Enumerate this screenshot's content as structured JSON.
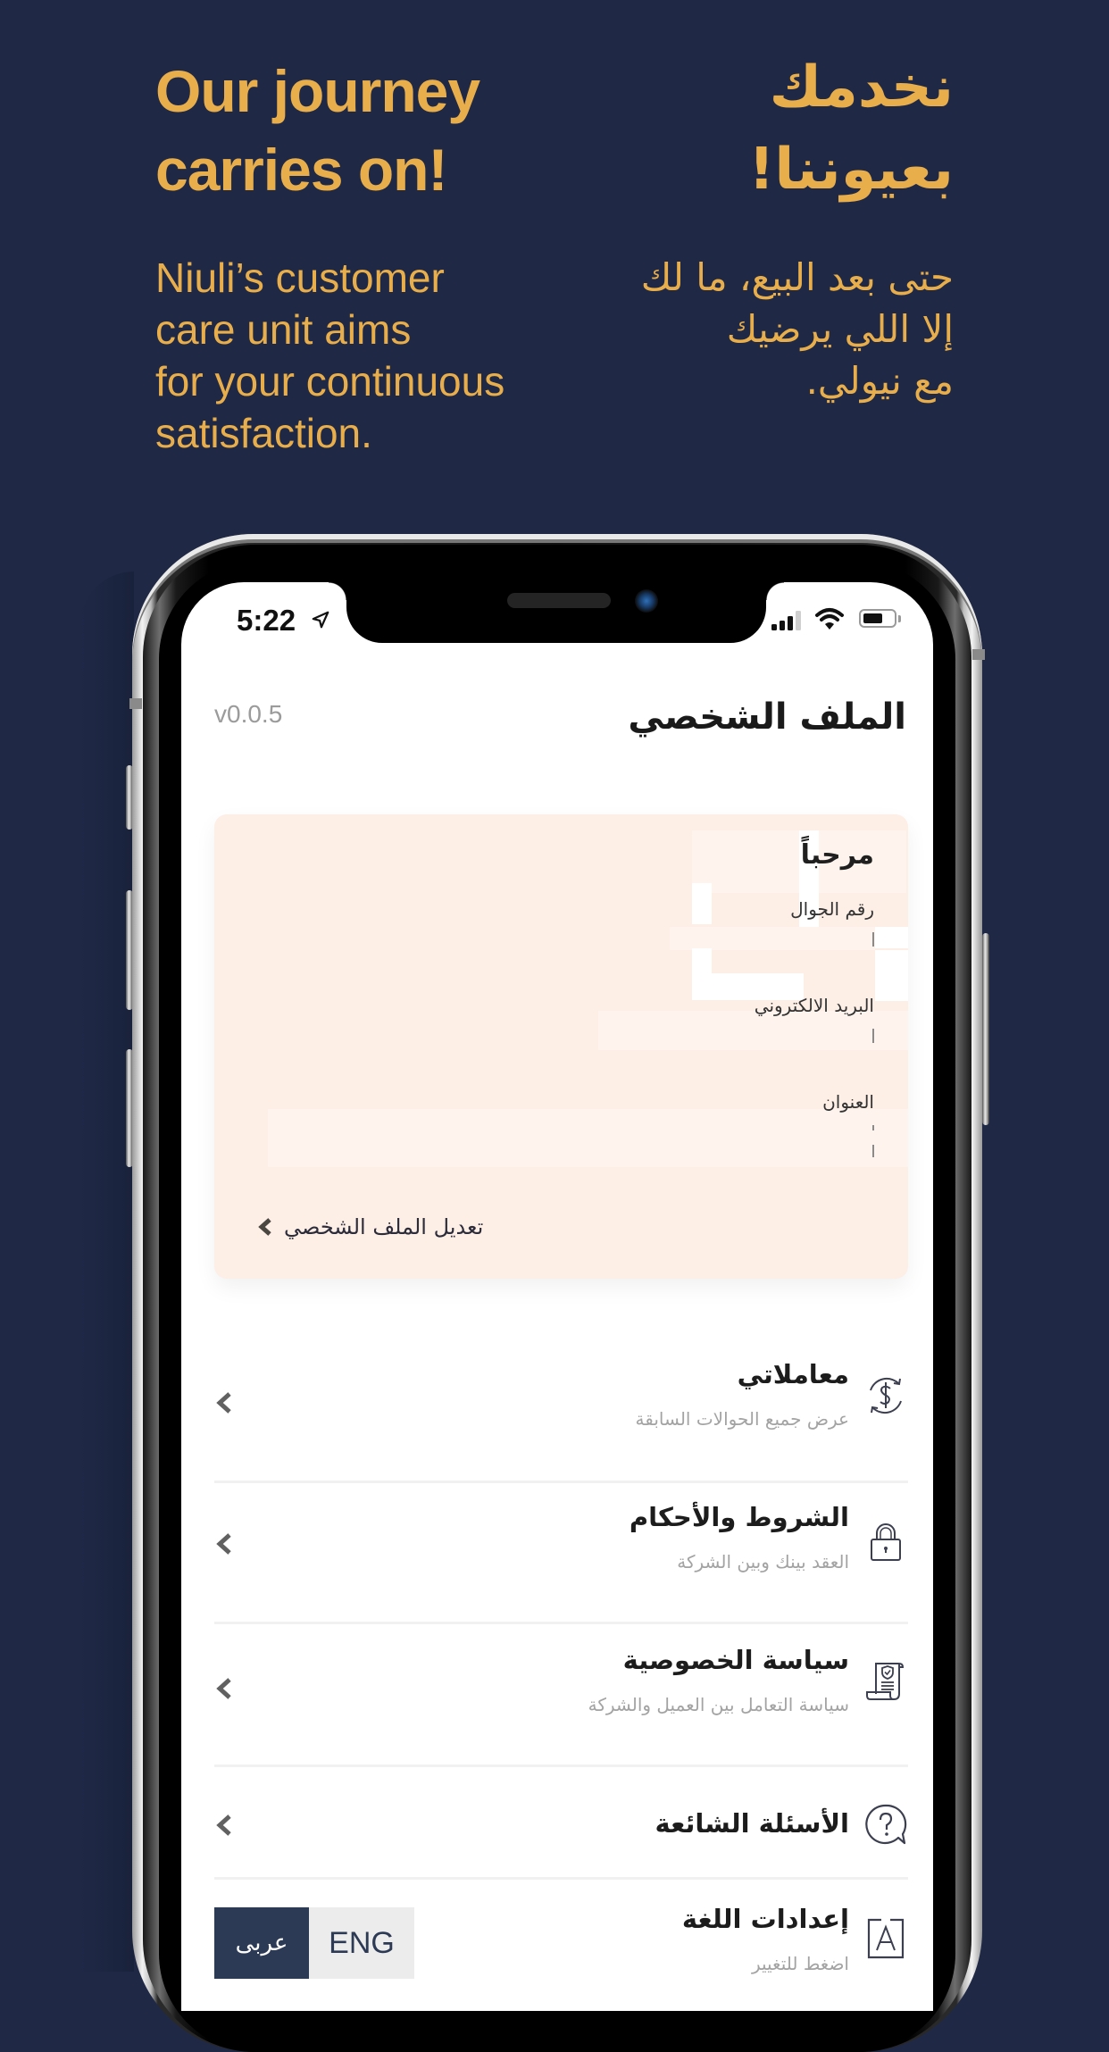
{
  "promo": {
    "en_title": "Our journey\ncarries on!",
    "ar_title": "نخدمك\nبعيوننا!",
    "en_body": "Niuli’s customer\ncare unit aims\nfor your continuous\nsatisfaction.",
    "ar_body": "حتى بعد البيع، ما لك\nإلا اللي يرضيك\nمع نيولي."
  },
  "colors": {
    "background": "#1f2946",
    "accent_gold": "#e8ae4c",
    "card_bg": "#fdeee6",
    "toggle_active": "#2d3a55",
    "toggle_inactive": "#ececec"
  },
  "status_bar": {
    "time": "5:22",
    "location_icon": "location-arrow-icon",
    "signal_bars_active": 3,
    "signal_bars_total": 4,
    "wifi_icon": "wifi-icon",
    "battery_level": 0.65
  },
  "header": {
    "version": "v0.0.5",
    "title": "الملف الشخصي"
  },
  "profile_card": {
    "greeting": "مرحباً",
    "fields": [
      {
        "label": "رقم الجوال",
        "value": ""
      },
      {
        "label": "البريد الالكتروني",
        "value": ""
      },
      {
        "label": "العنوان",
        "value": ""
      }
    ],
    "edit_link": "تعديل الملف الشخصي",
    "edit_icon": "chevron-left-icon"
  },
  "menu": {
    "items": [
      {
        "title": "معاملاتي",
        "subtitle": "عرض جميع الحوالات السابقة",
        "icon": "currency-exchange-icon"
      },
      {
        "title": "الشروط والأحكام",
        "subtitle": "العقد بينك وبين الشركة",
        "icon": "lock-icon"
      },
      {
        "title": "سياسة الخصوصية",
        "subtitle": "سياسة التعامل بين العميل والشركة",
        "icon": "privacy-document-icon"
      },
      {
        "title": "الأسئلة الشائعة",
        "subtitle": "",
        "icon": "question-bubble-icon"
      },
      {
        "title": "إعدادات اللغة",
        "subtitle": "اضغط للتغيير",
        "icon": "language-icon"
      }
    ]
  },
  "language_toggle": {
    "options": [
      "عربى",
      "ENG"
    ],
    "selected": "عربى"
  }
}
